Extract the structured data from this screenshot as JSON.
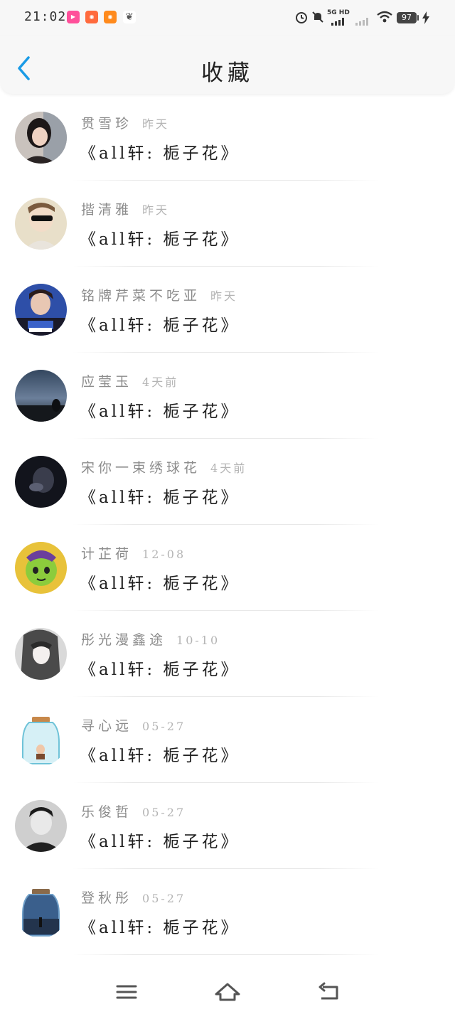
{
  "status_bar": {
    "time": "21:02",
    "network": "5G HD",
    "battery": "97",
    "app_icons": [
      {
        "name": "vivo-video-icon",
        "color": "#ff4f9a"
      },
      {
        "name": "app-orange-icon",
        "color": "#ff6a3d"
      },
      {
        "name": "app-orange-2-icon",
        "color": "#ff8a1c"
      },
      {
        "name": "app-leaf-icon",
        "color": "#555555"
      }
    ]
  },
  "header": {
    "title": "收藏",
    "back_icon": "chevron-left-icon",
    "accent_color": "#1a9be6"
  },
  "favorites": [
    {
      "username": "贯雪珍",
      "time": "昨天",
      "title": "《all轩: 栀子花》",
      "avatar": "avatar-girl-selfie"
    },
    {
      "username": "揩清雅",
      "time": "昨天",
      "title": "《all轩: 栀子花》",
      "avatar": "avatar-boy-sunglasses"
    },
    {
      "username": "铭牌芹菜不吃亚",
      "time": "昨天",
      "title": "《all轩: 栀子花》",
      "avatar": "avatar-young-man"
    },
    {
      "username": "应莹玉",
      "time": "4天前",
      "title": "《all轩: 栀子花》",
      "avatar": "avatar-dusk-sky"
    },
    {
      "username": "宋你一束绣球花",
      "time": "4天前",
      "title": "《all轩: 栀子花》",
      "avatar": "avatar-dark-portrait"
    },
    {
      "username": "计芷荷",
      "time": "12-08",
      "title": "《all轩: 栀子花》",
      "avatar": "avatar-green-cartoon"
    },
    {
      "username": "彤光漫鑫途",
      "time": "10-10",
      "title": "《all轩: 栀子花》",
      "avatar": "avatar-anime-girl"
    },
    {
      "username": "寻心远",
      "time": "05-27",
      "title": "《all轩: 栀子花》",
      "avatar": "avatar-jar-boy"
    },
    {
      "username": "乐俊哲",
      "time": "05-27",
      "title": "《all轩: 栀子花》",
      "avatar": "avatar-bw-boy"
    },
    {
      "username": "登秋彤",
      "time": "05-27",
      "title": "《all轩: 栀子花》",
      "avatar": "avatar-jar-city"
    }
  ],
  "nav_bar": {
    "menu_icon": "menu-icon",
    "home_icon": "home-icon",
    "back_icon": "return-icon"
  }
}
